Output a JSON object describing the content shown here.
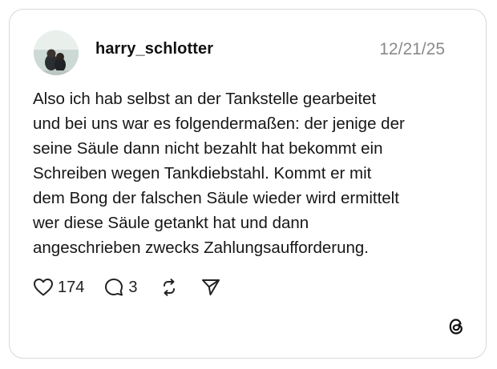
{
  "post": {
    "username": "harry_schlotter",
    "timestamp": "12/21/25",
    "text_lines": [
      "Also ich hab selbst an der Tankstelle gearbeitet",
      "und bei uns war es folgendermaßen: der jenige der",
      "seine Säule dann nicht bezahlt hat bekommt ein",
      "Schreiben wegen Tankdiebstahl. Kommt er mit",
      "dem Bong der falschen Säule wieder wird ermittelt",
      "wer diese Säule getankt hat und dann",
      "angeschrieben zwecks Zahlungsaufforderung."
    ]
  },
  "actions": {
    "likes": "174",
    "comments": "3"
  },
  "icons": {
    "like": "heart-icon",
    "comment": "comment-bubble-icon",
    "repost": "repost-icon",
    "share": "send-icon",
    "brand": "threads-logo-icon"
  },
  "colors": {
    "text": "#161616",
    "muted": "#8a8a8a",
    "border": "#d8d8d8"
  }
}
